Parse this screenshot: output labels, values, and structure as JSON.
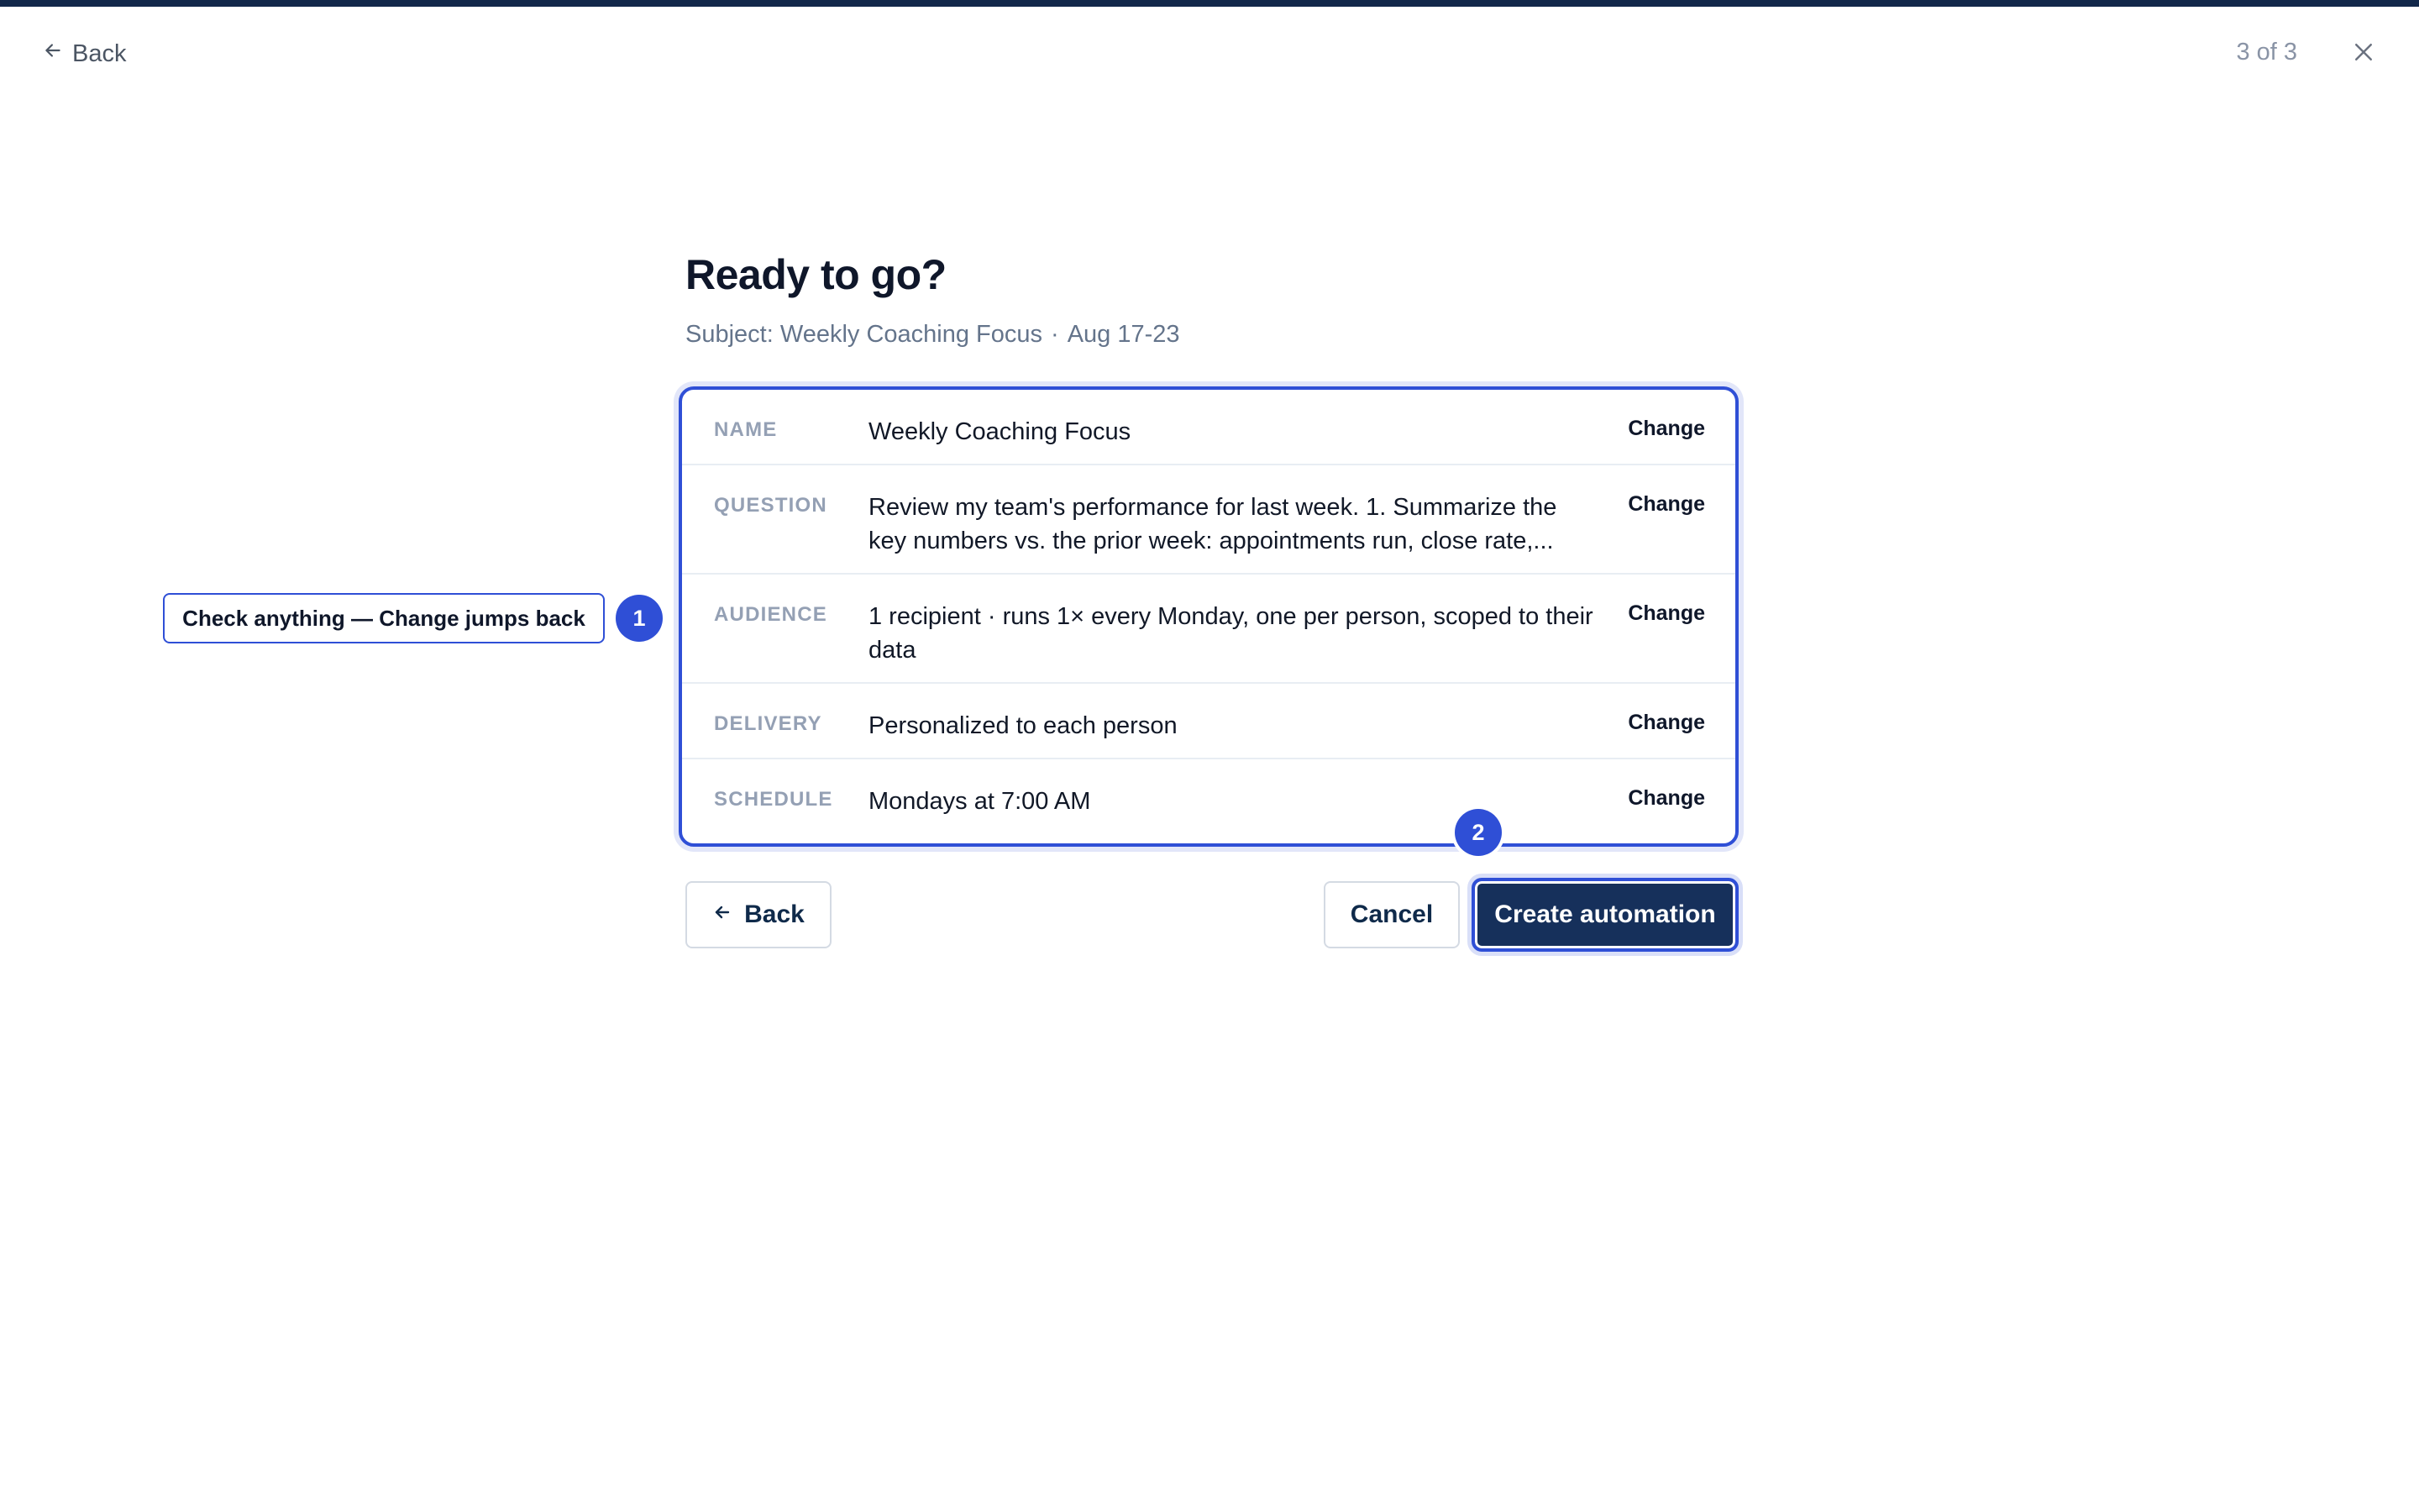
{
  "header": {
    "back_label": "Back",
    "step_text": "3 of 3",
    "close_icon": "close-icon"
  },
  "main": {
    "title": "Ready to go?",
    "subtitle_subject": "Subject: Weekly Coaching Focus",
    "subtitle_separator": "·",
    "subtitle_date": "Aug 17-23"
  },
  "summary": {
    "rows": [
      {
        "label": "NAME",
        "value": "Weekly Coaching Focus",
        "change_label": "Change"
      },
      {
        "label": "QUESTION",
        "value": "Review my team's performance for last week. 1. Summarize the key numbers vs. the prior week: appointments run, close rate,...",
        "change_label": "Change"
      },
      {
        "label": "AUDIENCE",
        "value": "1 recipient · runs 1× every Monday, one per person, scoped to their data",
        "change_label": "Change"
      },
      {
        "label": "DELIVERY",
        "value": "Personalized to each person",
        "change_label": "Change"
      },
      {
        "label": "SCHEDULE",
        "value": "Mondays at 7:00 AM",
        "change_label": "Change"
      }
    ]
  },
  "footer": {
    "back_label": "Back",
    "cancel_label": "Cancel",
    "create_label": "Create automation"
  },
  "annotations": {
    "callout_text": "Check anything — Change jumps back",
    "badge_1": "1",
    "badge_2": "2"
  },
  "colors": {
    "accent": "#2f4fd6",
    "primary_button": "#16305b",
    "top_stripe": "#12284a",
    "muted_text": "#64748b"
  }
}
